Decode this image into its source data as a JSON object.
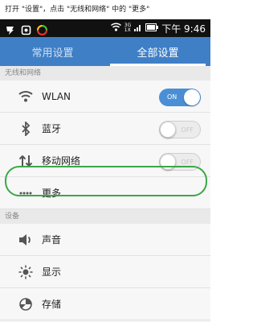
{
  "instruction": "打开 \"设置\"，点击 \"无线和网络\" 中的 \"更多\"",
  "status_bar": {
    "network_top": "3G",
    "network_bottom": "1X",
    "time": "下午 9:46"
  },
  "tabs": [
    {
      "label": "常用设置",
      "active": false
    },
    {
      "label": "全部设置",
      "active": true
    }
  ],
  "sections": [
    {
      "header": "无线和网络",
      "items": [
        {
          "label": "WLAN",
          "icon": "wifi-icon",
          "toggle": "ON"
        },
        {
          "label": "蓝牙",
          "icon": "bluetooth-icon",
          "toggle": "OFF"
        },
        {
          "label": "移动网络",
          "icon": "mobile-data-icon",
          "toggle": "OFF"
        },
        {
          "label": "更多...",
          "icon": "more-icon"
        }
      ]
    },
    {
      "header": "设备",
      "items": [
        {
          "label": "声音",
          "icon": "sound-icon"
        },
        {
          "label": "显示",
          "icon": "display-icon"
        },
        {
          "label": "存储",
          "icon": "storage-icon"
        }
      ]
    }
  ],
  "colors": {
    "tab_bar": "#3f7fc6",
    "toggle_on": "#4a8fd6",
    "highlight": "#3aa845"
  }
}
